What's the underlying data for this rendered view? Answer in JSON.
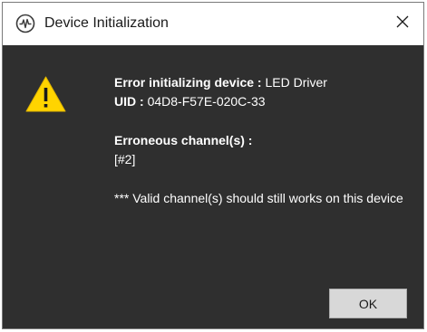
{
  "window": {
    "title": "Device Initialization"
  },
  "message": {
    "error_label": "Error initializing device :",
    "device_name": "LED Driver",
    "uid_label": "UID :",
    "uid_value": "04D8-F57E-020C-33",
    "channels_label": "Erroneous channel(s) :",
    "channels_value": "[#2]",
    "note": "*** Valid channel(s) should still works on this device"
  },
  "buttons": {
    "ok_label": "OK"
  },
  "icons": {
    "app": "waveform-circle-icon",
    "close": "close-icon",
    "warning": "warning-icon"
  },
  "colors": {
    "dialog_background": "#2f2f2f",
    "warning_yellow": "#ffd400",
    "text": "#ffffff"
  }
}
